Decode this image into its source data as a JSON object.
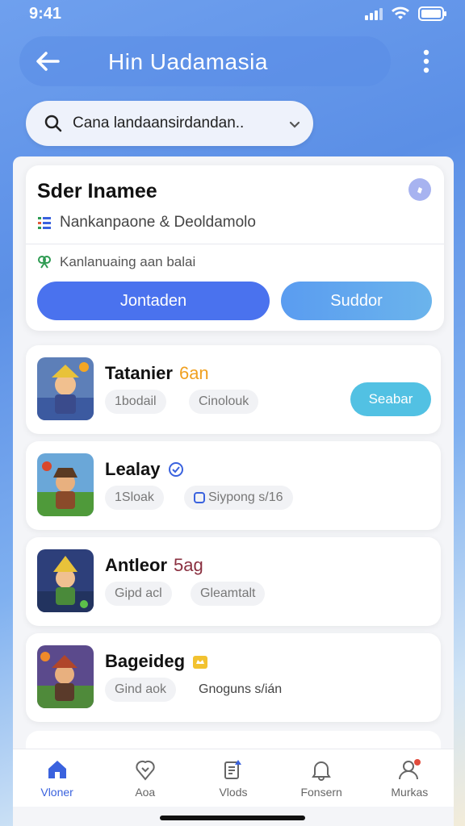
{
  "status_bar": {
    "time": "9:41"
  },
  "header": {
    "title": "Hin Uadamasia"
  },
  "search": {
    "text": "Cana landaansirdandan.."
  },
  "top_card": {
    "title": "Sder Inamee",
    "row1": "Nankanpaone & Deoldamolo",
    "row2": "Kanlanuaing aan balai",
    "primary_button": "Jontaden",
    "secondary_button": "Suddor"
  },
  "games": [
    {
      "name": "Tatanier",
      "accent": "6an",
      "accent_color": "#f0a020",
      "chip1": "1bodail",
      "chip2": "Cinolouk",
      "action": "Seabar"
    },
    {
      "name": "Lealay",
      "accent": "",
      "accent_color": "#3a62de",
      "chip1": "1Sloak",
      "chip2": "Siypong s/16",
      "action": ""
    },
    {
      "name": "Antleor",
      "accent": "5ag",
      "accent_color": "#8a3040",
      "chip1": "Gipd acl",
      "chip2": "Gleamtalt",
      "action": ""
    },
    {
      "name": "Bageideg",
      "accent": "",
      "accent_color": "#f0b020",
      "chip1": "Gind aok",
      "chip2": "Gnoguns s/ián",
      "action": ""
    }
  ],
  "bottom_nav": [
    {
      "label": "Vloner",
      "icon": "home-icon",
      "active": true
    },
    {
      "label": "Aoa",
      "icon": "heart-pin-icon",
      "active": false
    },
    {
      "label": "Vlods",
      "icon": "document-icon",
      "active": false
    },
    {
      "label": "Fonsern",
      "icon": "bell-icon",
      "active": false
    },
    {
      "label": "Murkas",
      "icon": "profile-icon",
      "active": false
    }
  ],
  "colors": {
    "accent": "#4a72ee",
    "action": "#52c1e3",
    "badge": "#e14b3c"
  }
}
